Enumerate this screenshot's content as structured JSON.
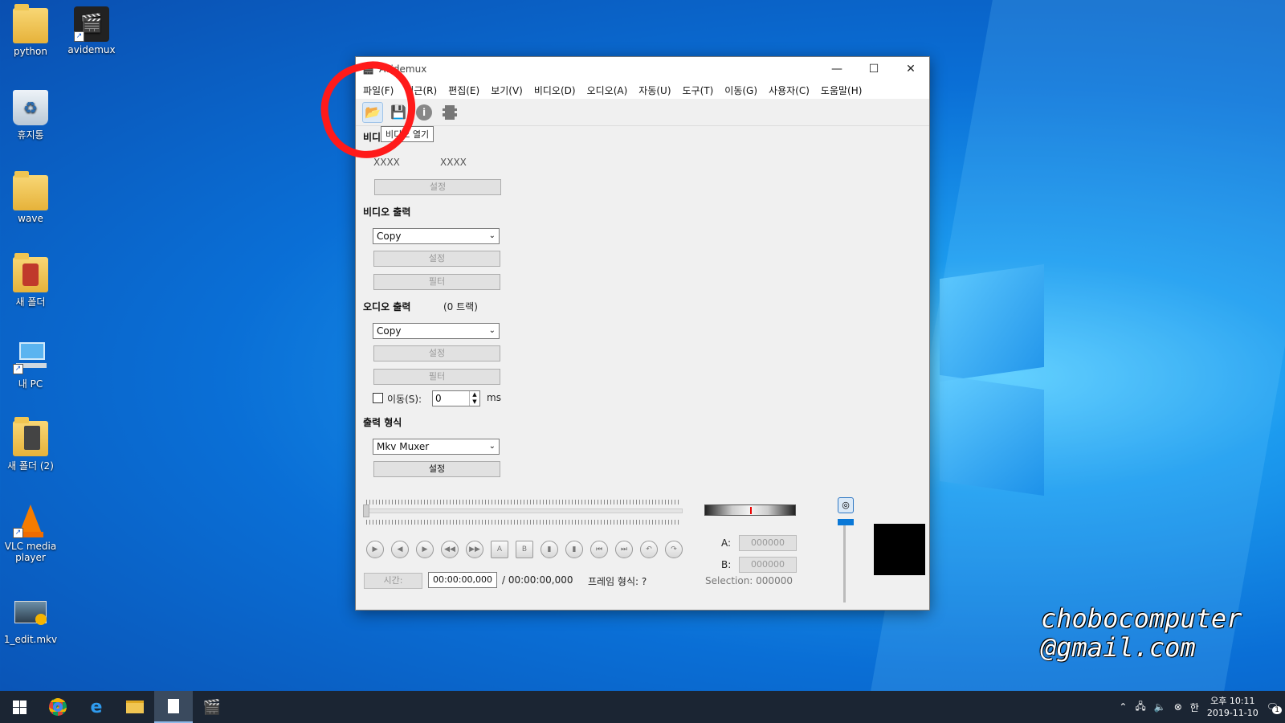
{
  "desktop": {
    "icons": [
      {
        "label": "python",
        "icon": "folder-icon"
      },
      {
        "label": "avidemux",
        "icon": "avidemux-icon"
      },
      {
        "label": "휴지통",
        "icon": "recycle-bin-icon"
      },
      {
        "label": "wave",
        "icon": "folder-icon"
      },
      {
        "label": "새 폴더",
        "icon": "folder-icon"
      },
      {
        "label": "내 PC",
        "icon": "computer-icon"
      },
      {
        "label": "새 폴더 (2)",
        "icon": "folder-icon"
      },
      {
        "label": "VLC media player",
        "icon": "vlc-icon"
      },
      {
        "label": "1_edit.mkv",
        "icon": "video-file-icon"
      }
    ],
    "watermark_line1": "chobocomputer",
    "watermark_line2": "@gmail.com"
  },
  "window": {
    "title": "Avidemux",
    "menu": [
      "파일(F)",
      "최근(R)",
      "편집(E)",
      "보기(V)",
      "비디오(D)",
      "오디오(A)",
      "자동(U)",
      "도구(T)",
      "이동(G)",
      "사용자(C)",
      "도움말(H)"
    ],
    "tooltip": "비디오 열기",
    "video_decoder": {
      "label": "비디오 디코더",
      "value1": "XXXX",
      "value2": "XXXX",
      "config": "설정"
    },
    "video_output": {
      "label": "비디오 출력",
      "codec": "Copy",
      "config": "설정",
      "filters": "필터"
    },
    "audio_output": {
      "label": "오디오 출력",
      "tracks": "(0 트랙)",
      "codec": "Copy",
      "config": "설정",
      "filters": "필터",
      "shift_label": "이동(S):",
      "shift_value": "0",
      "shift_unit": "ms"
    },
    "output_format": {
      "label": "출력 형식",
      "muxer": "Mkv Muxer",
      "config": "설정"
    },
    "time_label": "시간:",
    "current_time": "00:00:00,000",
    "total_time": "/ 00:00:00,000",
    "frame_type": "프레임 형식: ?",
    "a_label": "A:",
    "a_value": "000000",
    "b_label": "B:",
    "b_value": "000000",
    "selection": "Selection: 000000"
  },
  "taskbar": {
    "time_line1": "오후 10:11",
    "time_line2": "2019-11-10",
    "ime": "한",
    "notif_count": "1"
  },
  "colors": {
    "accent": "#0a78d7",
    "annotation": "#ff1a1a"
  }
}
